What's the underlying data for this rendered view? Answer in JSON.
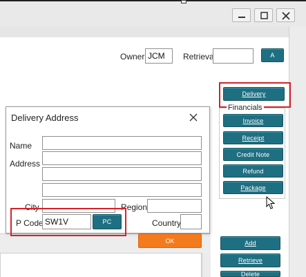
{
  "window": {
    "minimize_icon": "minimize-icon",
    "maximize_icon": "maximize-icon",
    "close_icon": "close-icon"
  },
  "header": {
    "owner_label": "Owner",
    "owner_value": "JCM",
    "retrieval_label": "Retrieval",
    "retrieval_value": "",
    "retrieval_button": "A"
  },
  "sidebar": {
    "delivery_button": "Delivery",
    "financials_title": "Financials",
    "buttons": [
      "Invoice",
      "Receipt",
      "Credit Note",
      "Refund",
      "Package"
    ]
  },
  "bottom_actions": [
    "Add",
    "Retrieve",
    "Delete"
  ],
  "dialog": {
    "title": "Delivery Address",
    "name_label": "Name",
    "address_label": "Address",
    "city_label": "City",
    "region_label": "Region",
    "pcode_label": "P Code",
    "pcode_value": "SW1V",
    "pc_button": "PC",
    "country_label": "Country",
    "ok_button": "OK"
  },
  "colors": {
    "teal_button": "#1f6f82",
    "ok_button": "#f47a1e",
    "highlight": "#d42127"
  }
}
